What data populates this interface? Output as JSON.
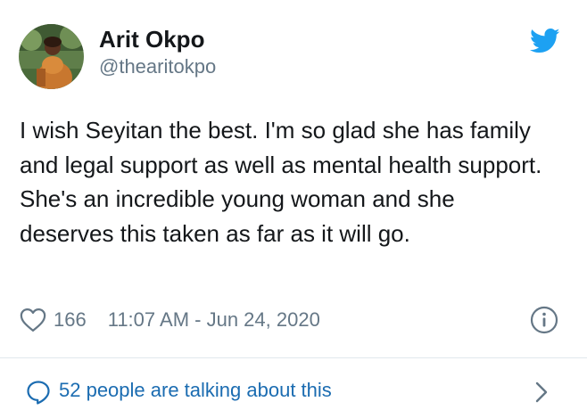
{
  "tweet": {
    "author": {
      "display_name": "Arit Okpo",
      "handle": "@thearitokpo"
    },
    "text": "I wish Seyitan the best. I'm so glad she has family and legal support as well as mental health support. She's an incredible young woman and she deserves this taken as far as it will go.",
    "likes": "166",
    "timestamp": "11:07 AM - Jun 24, 2020",
    "conversation_label": "52 people are talking about this"
  },
  "icons": {
    "brand": "twitter-bird-icon",
    "like": "heart-icon",
    "info": "info-icon",
    "conversation": "speech-bubble-icon",
    "more": "chevron-right-icon"
  },
  "colors": {
    "brand_blue": "#1da1f2",
    "link_blue": "#1b6cb1",
    "secondary_text": "#657786",
    "primary_text": "#14171a",
    "divider": "#e1e8ed"
  }
}
